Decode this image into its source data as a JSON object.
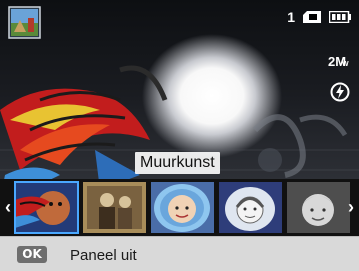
{
  "status": {
    "shots_remaining": "1",
    "resolution": "2M",
    "resolution_suffix": "W"
  },
  "effect": {
    "current_name": "Muurkunst"
  },
  "filters": {
    "items": [
      {
        "name": "muurkunst",
        "selected": true
      },
      {
        "name": "vintage"
      },
      {
        "name": "fisheye-portrait"
      },
      {
        "name": "sketch-portrait"
      },
      {
        "name": "soft-portrait"
      }
    ]
  },
  "helpbar": {
    "key": "OK",
    "text": "Paneel uit"
  },
  "icons": {
    "mode": "scene-thumbnail-icon",
    "storage": "memory-card-icon",
    "battery": "battery-full-icon",
    "flash": "flash-auto-icon",
    "prev": "chevron-left-icon",
    "next": "chevron-right-icon"
  },
  "colors": {
    "selection": "#4aa8ff",
    "helpbar_bg": "#d9d9d9"
  }
}
